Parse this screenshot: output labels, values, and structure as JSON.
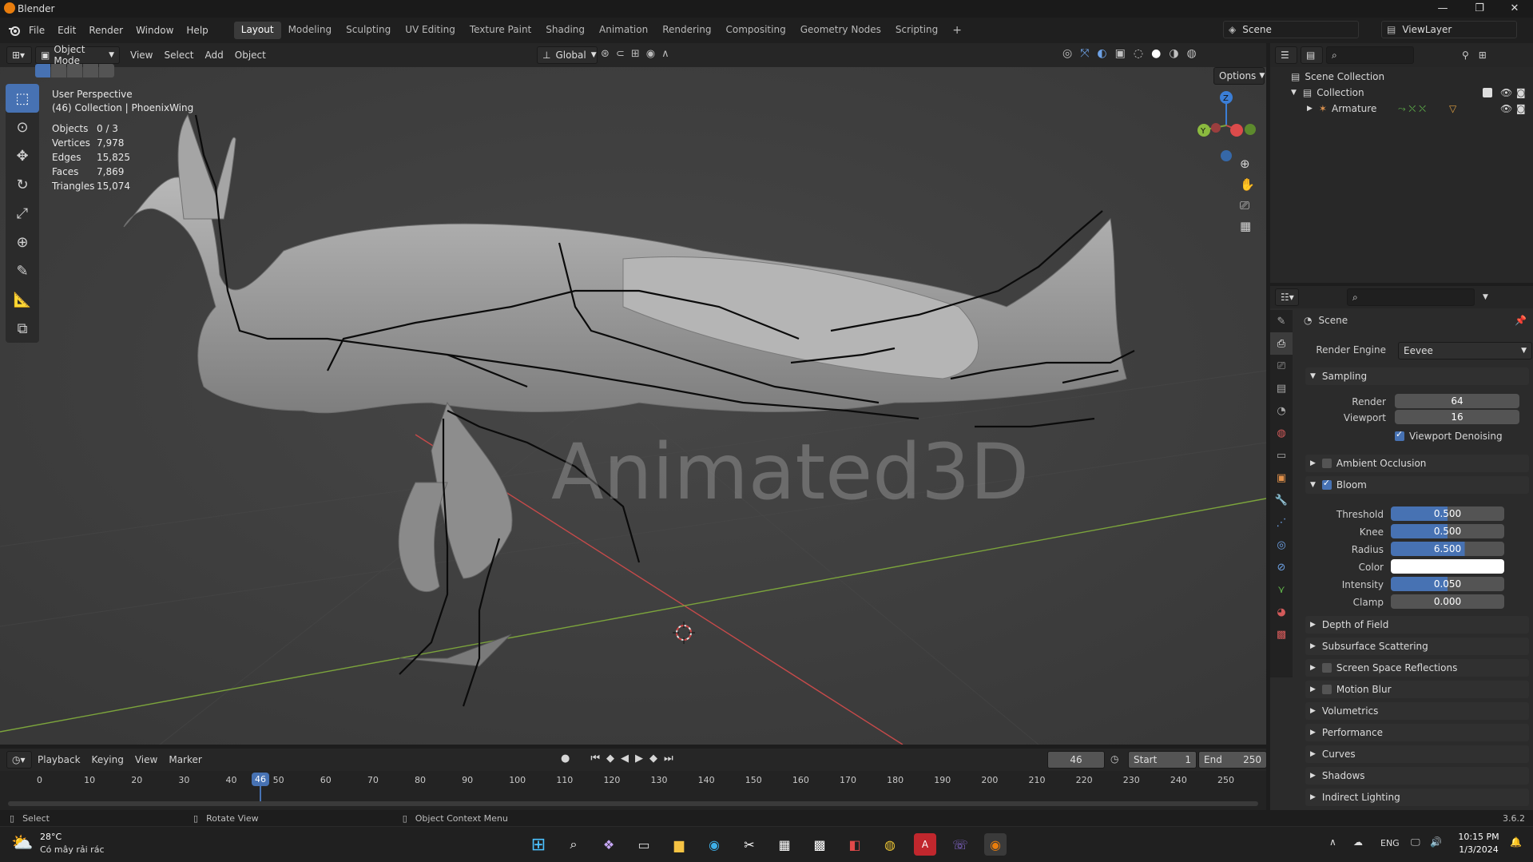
{
  "app": {
    "title": "Blender",
    "version": "3.6.2"
  },
  "window_controls": [
    "—",
    "❐",
    "✕"
  ],
  "menus": [
    "File",
    "Edit",
    "Render",
    "Window",
    "Help"
  ],
  "workspaces": [
    {
      "label": "Layout",
      "active": true
    },
    {
      "label": "Modeling",
      "active": false
    },
    {
      "label": "Sculpting",
      "active": false
    },
    {
      "label": "UV Editing",
      "active": false
    },
    {
      "label": "Texture Paint",
      "active": false
    },
    {
      "label": "Shading",
      "active": false
    },
    {
      "label": "Animation",
      "active": false
    },
    {
      "label": "Rendering",
      "active": false
    },
    {
      "label": "Compositing",
      "active": false
    },
    {
      "label": "Geometry Nodes",
      "active": false
    },
    {
      "label": "Scripting",
      "active": false
    }
  ],
  "scene_selector": {
    "label": "Scene"
  },
  "viewlayer_selector": {
    "label": "ViewLayer"
  },
  "viewport_header": {
    "mode": "Object Mode",
    "menus": [
      "View",
      "Select",
      "Add",
      "Object"
    ],
    "transform_orientation": "Global",
    "options_label": "Options"
  },
  "viewport_overlay": {
    "perspective": "User Perspective",
    "collection": "(46) Collection | PhoenixWing",
    "stats": [
      {
        "label": "Objects",
        "value": "0 / 3"
      },
      {
        "label": "Vertices",
        "value": "7,978"
      },
      {
        "label": "Edges",
        "value": "15,825"
      },
      {
        "label": "Faces",
        "value": "7,869"
      },
      {
        "label": "Triangles",
        "value": "15,074"
      }
    ],
    "watermark": "Animated3D"
  },
  "gizmo": {
    "axes": [
      "Z",
      "Y",
      "X"
    ]
  },
  "tools": [
    "select-box",
    "cursor",
    "move",
    "rotate",
    "scale",
    "transform",
    "annotate",
    "measure",
    "add-cube"
  ],
  "outliner": {
    "root": "Scene Collection",
    "items": [
      {
        "label": "Collection",
        "depth": 1
      },
      {
        "label": "Armature",
        "depth": 2
      }
    ]
  },
  "properties": {
    "context": "Scene",
    "render_engine_label": "Render Engine",
    "render_engine": "Eevee",
    "sampling": {
      "label": "Sampling",
      "render_label": "Render",
      "render": "64",
      "viewport_label": "Viewport",
      "viewport": "16",
      "denoise_label": "Viewport Denoising",
      "denoise": true
    },
    "ambient_occlusion": {
      "label": "Ambient Occlusion",
      "enabled": false
    },
    "bloom": {
      "label": "Bloom",
      "enabled": true,
      "fields": [
        {
          "label": "Threshold",
          "value": "0.500",
          "fill": 0.5
        },
        {
          "label": "Knee",
          "value": "0.500",
          "fill": 0.5
        },
        {
          "label": "Radius",
          "value": "6.500",
          "fill": 0.65
        },
        {
          "label": "Color",
          "value": "",
          "color": "#ffffff"
        },
        {
          "label": "Intensity",
          "value": "0.050",
          "fill": 0.5
        },
        {
          "label": "Clamp",
          "value": "0.000",
          "fill": 0
        }
      ]
    },
    "sections": [
      {
        "label": "Depth of Field",
        "checkbox": false
      },
      {
        "label": "Subsurface Scattering",
        "checkbox": false
      },
      {
        "label": "Screen Space Reflections",
        "checkbox": true
      },
      {
        "label": "Motion Blur",
        "checkbox": true
      },
      {
        "label": "Volumetrics",
        "checkbox": false
      },
      {
        "label": "Performance",
        "checkbox": false
      },
      {
        "label": "Curves",
        "checkbox": false
      },
      {
        "label": "Shadows",
        "checkbox": false
      },
      {
        "label": "Indirect Lighting",
        "checkbox": false
      }
    ]
  },
  "timeline": {
    "menus": [
      "Playback",
      "Keying",
      "View",
      "Marker"
    ],
    "current_frame": "46",
    "start_label": "Start",
    "start": "1",
    "end_label": "End",
    "end": "250",
    "ticks": [
      "0",
      "10",
      "20",
      "30",
      "40",
      "50",
      "60",
      "70",
      "80",
      "90",
      "100",
      "110",
      "120",
      "130",
      "140",
      "150",
      "160",
      "170",
      "180",
      "190",
      "200",
      "210",
      "220",
      "230",
      "240",
      "250"
    ]
  },
  "statusbar": {
    "select": "Select",
    "rotate": "Rotate View",
    "context": "Object Context Menu",
    "version": "3.6.2"
  },
  "taskbar": {
    "weather_temp": "28°C",
    "weather_desc": "Có mây rải rác",
    "lang": "ENG",
    "time": "10:15 PM",
    "date": "1/3/2024"
  },
  "colors": {
    "accent": "#4772b3",
    "x_axis": "#c64a4a",
    "y_axis": "#7ca43c",
    "z_axis": "#3b7ed6"
  }
}
